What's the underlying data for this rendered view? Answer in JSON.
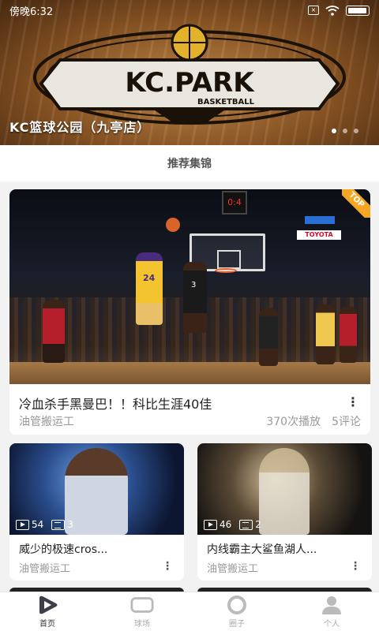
{
  "status_bar": {
    "time": "傍晚6:32"
  },
  "banner": {
    "caption": "KC篮球公园（九亭店）",
    "logo_text": "KC.PARK",
    "logo_subtext": "BASKETBALL",
    "slides": 3,
    "active_slide": 1
  },
  "section": {
    "title": "推荐集锦"
  },
  "featured": {
    "title": "冷血杀手黑曼巴！！科比生涯40佳",
    "author": "油管搬运工",
    "plays": "370次播放",
    "comments": "5评论",
    "badge": "TOP",
    "shot_clock": "0:4",
    "jersey_1": "24",
    "jersey_2": "3",
    "sponsor": "TOYOTA"
  },
  "cards": [
    {
      "title": "威少的极速cros...",
      "author": "油管搬运工",
      "videos": "54",
      "lists": "3"
    },
    {
      "title": "内线霸主大鲨鱼湖人...",
      "author": "油管搬运工",
      "videos": "46",
      "lists": "2"
    }
  ],
  "tabs": [
    {
      "label": "首页",
      "icon": "home-play-icon",
      "active": true
    },
    {
      "label": "球场",
      "icon": "court-icon",
      "active": false
    },
    {
      "label": "圈子",
      "icon": "circle-icon",
      "active": false
    },
    {
      "label": "个人",
      "icon": "person-icon",
      "active": false
    }
  ],
  "colors": {
    "accent": "#333333",
    "inactive": "#aaaaaa",
    "badge": "#f5a623"
  }
}
